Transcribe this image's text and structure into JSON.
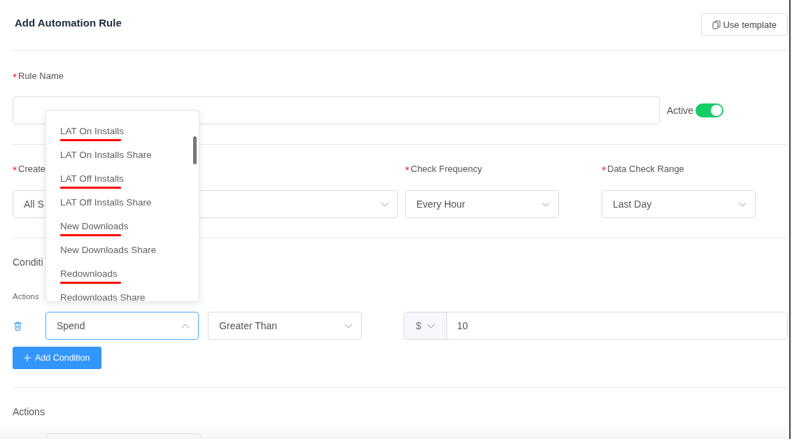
{
  "title": "Add Automation Rule",
  "template_button": {
    "label": "Use template"
  },
  "rule_name": {
    "label": "Rule Name",
    "required": true
  },
  "active": {
    "label": "Active",
    "on": true
  },
  "settings": [
    {
      "label": "Create",
      "required": true,
      "value": "All S"
    },
    {
      "label": "Check Frequency",
      "required": true,
      "value": "Every Hour"
    },
    {
      "label": "Data Check Range",
      "required": true,
      "value": "Last Day"
    }
  ],
  "conditions_label": "Conditi",
  "actions_hint": "Actions",
  "condition": {
    "metric": "Spend",
    "expanded": true,
    "operator": "Greater Than",
    "currency": "$",
    "amount": "10"
  },
  "metric_options": [
    {
      "label": "LAT On Installs",
      "underlined": true
    },
    {
      "label": "LAT On Installs Share",
      "underlined": false
    },
    {
      "label": "LAT Off Installs",
      "underlined": true
    },
    {
      "label": "LAT Off Installs Share",
      "underlined": false
    },
    {
      "label": "New Downloads",
      "underlined": true
    },
    {
      "label": "New Downloads Share",
      "underlined": false
    },
    {
      "label": "Redownloads",
      "underlined": true
    },
    {
      "label": "Redownloads Share",
      "underlined": false
    }
  ],
  "add_condition_button": {
    "label": "Add Condition"
  },
  "actions_label": "Actions"
}
